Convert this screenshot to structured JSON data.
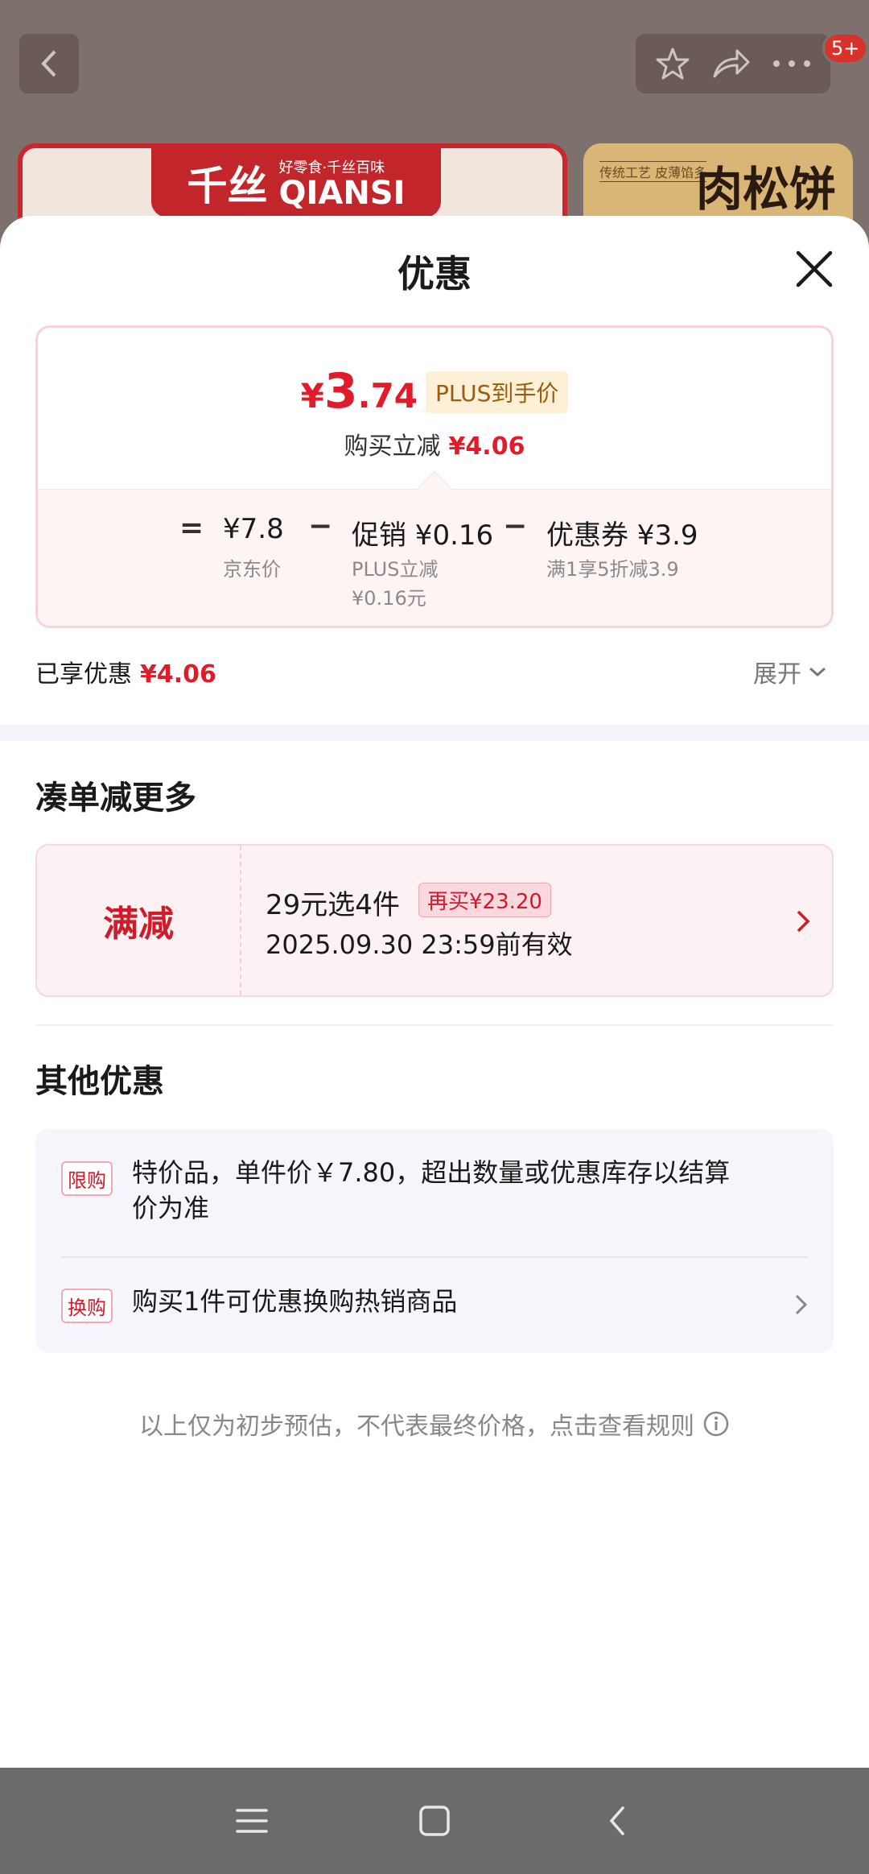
{
  "background": {
    "badge_count": "5+",
    "banner1_brand_cn": "千丝",
    "banner1_slogan": "好零食·千丝百味",
    "banner1_brand_en": "QIANSI",
    "banner2_small": "传统工艺 皮薄馅多",
    "banner2_title": "肉松饼"
  },
  "sheet": {
    "title": "优惠"
  },
  "price_card": {
    "final_currency": "¥",
    "final_int": "3",
    "final_dec": ".74",
    "plus_label": "PLUS到手价",
    "reduce_label": "购买立减",
    "reduce_value": "¥4.06",
    "eq": "=",
    "minus": "−",
    "jd_price": "¥7.8",
    "jd_price_label": "京东价",
    "promo": "促销 ¥0.16",
    "promo_sub1": "PLUS立减",
    "promo_sub2": "¥0.16元",
    "coupon": "优惠券 ¥3.9",
    "coupon_sub": "满1享5折减3.9"
  },
  "enjoyed": {
    "label": "已享优惠",
    "value": "¥4.06",
    "expand": "展开"
  },
  "more_section": {
    "title": "凑单减更多",
    "coupon_type": "满减",
    "coupon_title": "29元选4件",
    "coupon_tag": "再买¥23.20",
    "coupon_date": "2025.09.30 23:59前有效"
  },
  "other_section": {
    "title": "其他优惠",
    "items": [
      {
        "tag": "限购",
        "text_line1": "特价品，单件价￥7.80，超出数量或优惠库存以结算",
        "text_line2": "价为准"
      },
      {
        "tag": "换购",
        "text_line1": "购买1件可优惠换购热销商品"
      }
    ]
  },
  "disclaimer": "以上仅为初步预估，不代表最终价格，点击查看规则",
  "colors": {
    "accent_red": "#e21b2b",
    "plus_gold": "#9b5c10",
    "nav_bar": "#6b6b6b"
  }
}
